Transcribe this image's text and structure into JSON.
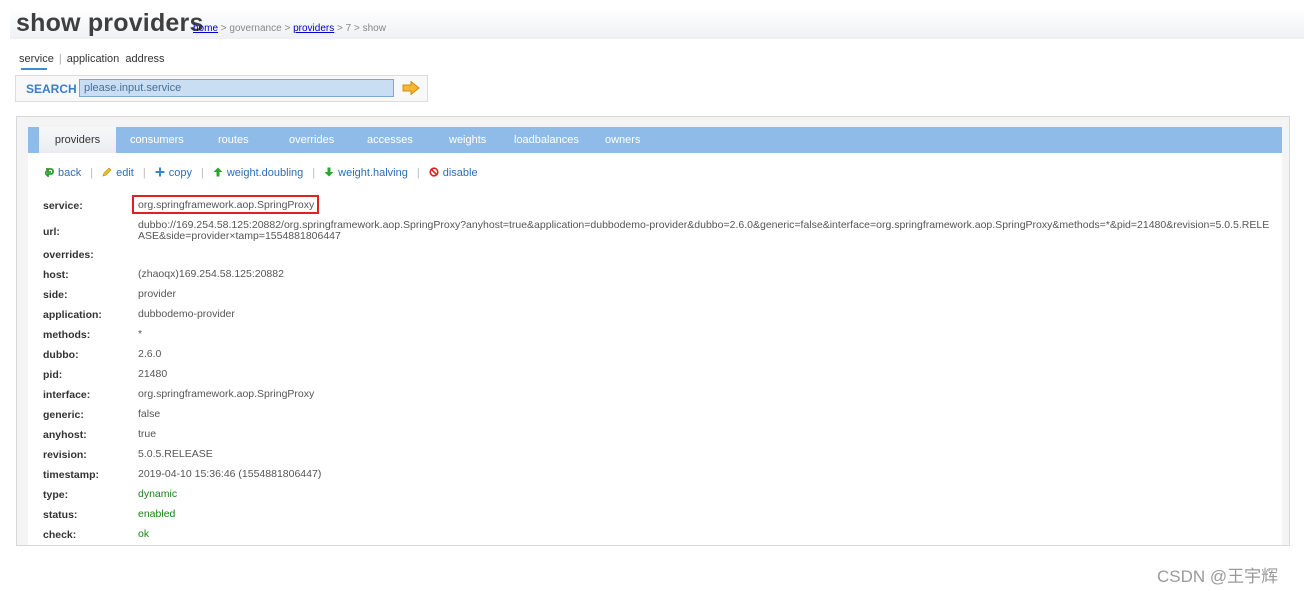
{
  "header": {
    "title": "show providers",
    "breadcrumb": {
      "home": "home",
      "sep1": ">",
      "governance": "governance",
      "sep2": ">",
      "providers": "providers",
      "sep3": ">",
      "id": "7",
      "sep4": ">",
      "show": "show"
    }
  },
  "subtabs": {
    "service": "service",
    "separator": "|",
    "application": "application",
    "address": "address"
  },
  "search": {
    "label": "SEARCH",
    "placeholder": "please.input.service"
  },
  "tabs": [
    {
      "label": "providers",
      "active": true
    },
    {
      "label": "consumers"
    },
    {
      "label": "routes"
    },
    {
      "label": "overrides"
    },
    {
      "label": "accesses"
    },
    {
      "label": "weights"
    },
    {
      "label": "loadbalances"
    },
    {
      "label": "owners"
    }
  ],
  "actions": {
    "back": "back",
    "edit": "edit",
    "copy": "copy",
    "weight_doubling": "weight.doubling",
    "weight_halving": "weight.halving",
    "disable": "disable",
    "separator": "|"
  },
  "details": {
    "service": {
      "label": "service:",
      "value": "org.springframework.aop.SpringProxy"
    },
    "url": {
      "label": "url:",
      "value": "dubbo://169.254.58.125:20882/org.springframework.aop.SpringProxy?anyhost=true&application=dubbodemo-provider&dubbo=2.6.0&generic=false&interface=org.springframework.aop.SpringProxy&methods=*&pid=21480&revision=5.0.5.RELEASE&side=provider×tamp=1554881806447"
    },
    "overrides": {
      "label": "overrides:",
      "value": ""
    },
    "host": {
      "label": "host:",
      "value": "(zhaoqx)169.254.58.125:20882"
    },
    "side": {
      "label": "side:",
      "value": "provider"
    },
    "application": {
      "label": "application:",
      "value": "dubbodemo-provider"
    },
    "methods": {
      "label": "methods:",
      "value": "*"
    },
    "dubbo": {
      "label": "dubbo:",
      "value": "2.6.0"
    },
    "pid": {
      "label": "pid:",
      "value": "21480"
    },
    "interface": {
      "label": "interface:",
      "value": "org.springframework.aop.SpringProxy"
    },
    "generic": {
      "label": "generic:",
      "value": "false"
    },
    "anyhost": {
      "label": "anyhost:",
      "value": "true"
    },
    "revision": {
      "label": "revision:",
      "value": "5.0.5.RELEASE"
    },
    "timestamp": {
      "label": "timestamp:",
      "value": "2019-04-10 15:36:46 (1554881806447)"
    },
    "type": {
      "label": "type:",
      "value": "dynamic"
    },
    "status": {
      "label": "status:",
      "value": "enabled"
    },
    "check": {
      "label": "check:",
      "value": "ok"
    }
  },
  "watermark": "CSDN @王宇辉",
  "colors": {
    "tabbar": "#8ebbe8",
    "link": "#2b6fb8",
    "highlight": "#dd2222",
    "status_green": "#1a7f1a"
  },
  "icons": {
    "back": "green-return-arrow-icon",
    "edit": "pencil-icon",
    "copy": "plus-icon",
    "weight_doubling": "green-up-arrow-icon",
    "weight_halving": "green-down-arrow-icon",
    "disable": "red-forbidden-icon",
    "search_go": "orange-right-arrow-icon"
  }
}
